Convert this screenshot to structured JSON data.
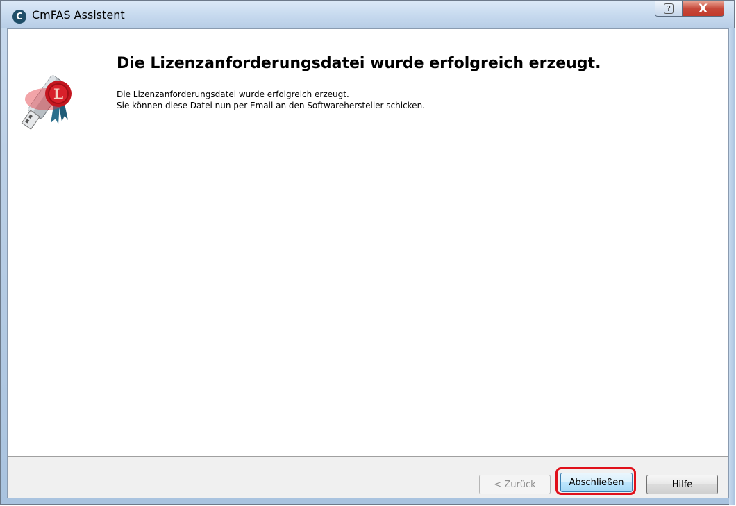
{
  "window": {
    "title": "CmFAS Assistent",
    "app_icon": "C",
    "help_button": "?",
    "close_button": "X"
  },
  "main": {
    "heading": "Die Lizenzanforderungsdatei wurde erfolgreich erzeugt.",
    "lines": [
      "Die Lizenzanforderungsdatei wurde erfolgreich erzeugt.",
      "Sie können diese Datei nun per Email an den Softwarehersteller schicken."
    ],
    "icon": "usb-dongle-license-seal-icon"
  },
  "footer": {
    "back_label": "< Zurück",
    "finish_label": "Abschließen",
    "help_label": "Hilfe"
  },
  "colors": {
    "highlight": "#e0101a",
    "seal_red": "#d8202a"
  }
}
